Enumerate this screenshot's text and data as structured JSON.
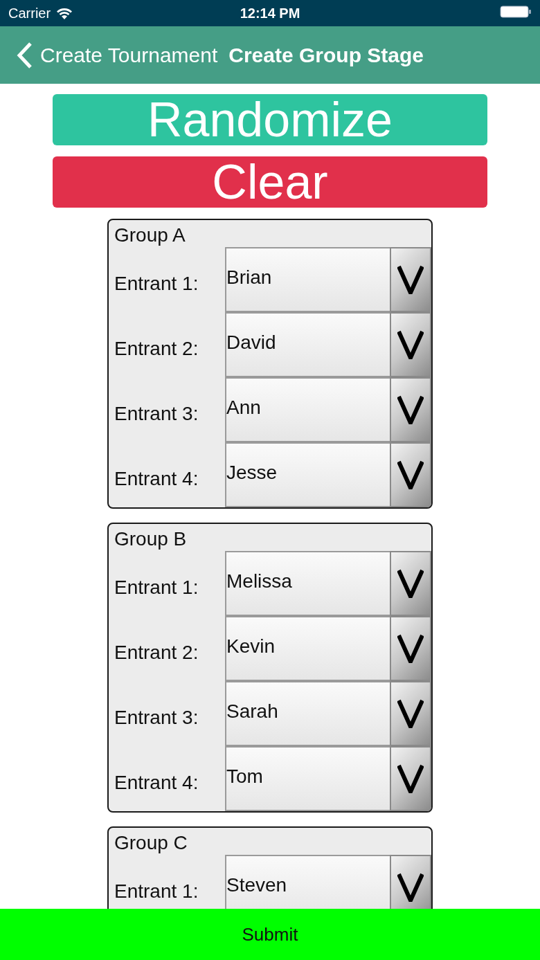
{
  "status_bar": {
    "carrier": "Carrier",
    "time": "12:14 PM"
  },
  "nav_bar": {
    "back_label": "Create Tournament",
    "title": "Create Group Stage"
  },
  "actions": [
    {
      "label": "Randomize",
      "kind": "randomize"
    },
    {
      "label": "Clear",
      "kind": "clear"
    }
  ],
  "groups": [
    {
      "title": "Group A",
      "entrants": [
        {
          "label": "Entrant 1:",
          "value": "Brian"
        },
        {
          "label": "Entrant 2:",
          "value": "David"
        },
        {
          "label": "Entrant 3:",
          "value": "Ann"
        },
        {
          "label": "Entrant 4:",
          "value": "Jesse"
        }
      ]
    },
    {
      "title": "Group B",
      "entrants": [
        {
          "label": "Entrant 1:",
          "value": "Melissa"
        },
        {
          "label": "Entrant 2:",
          "value": "Kevin"
        },
        {
          "label": "Entrant 3:",
          "value": "Sarah"
        },
        {
          "label": "Entrant 4:",
          "value": "Tom"
        }
      ]
    },
    {
      "title": "Group C",
      "entrants": [
        {
          "label": "Entrant 1:",
          "value": "Steven"
        }
      ]
    }
  ],
  "submit_button": {
    "label": "Submit"
  }
}
